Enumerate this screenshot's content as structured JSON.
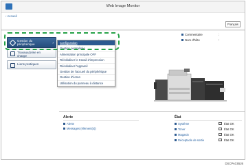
{
  "app_title": "Web Image Monitor",
  "home_link": "‹ Accueil",
  "language": "Français",
  "nav": {
    "device": "Gestion du périphérique",
    "printer": "Travaux/prise en charge",
    "links": "Liens pratiques"
  },
  "menu": [
    "Configuration",
    "Gestion centralisée",
    "Alimentation principale OFF",
    "Réinitialiser le travail d'impression",
    "Réinitialiser l'appareil",
    "Gestion de l'accueil du périphérique",
    "Gestion d'écran",
    "Utilisation du panneau à distance"
  ],
  "info": {
    "comment_label": "Commentaire",
    "host_label": "Nom d'hôte",
    "comment_value": ":",
    "host_value": ":"
  },
  "alert": {
    "title": "Alerte",
    "items": [
      "Alerte",
      "Messages (élément(s))"
    ]
  },
  "state": {
    "title": "État",
    "items": [
      {
        "label": "Système",
        "value": "État OK"
      },
      {
        "label": "Toner",
        "value": "État OK"
      },
      {
        "label": "Magasin",
        "value": "État OK"
      },
      {
        "label": "Réceptacle de sortie",
        "value": "État OK"
      }
    ]
  },
  "figure_code": "DSCPAC6526",
  "colors": {
    "highlight": "#24a146",
    "nav_active": "#2c5a90",
    "link": "#1f5c9e"
  }
}
